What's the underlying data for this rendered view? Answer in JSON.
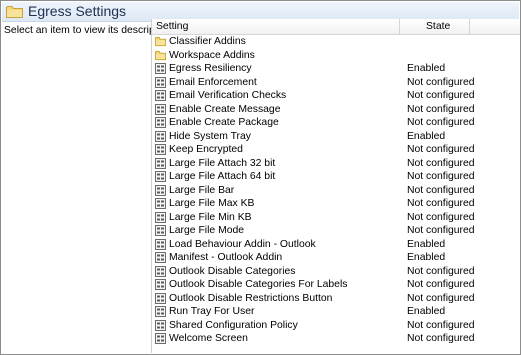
{
  "window": {
    "title": "Egress Settings"
  },
  "description_pane": {
    "text": "Select an item to view its description."
  },
  "columns": {
    "setting": "Setting",
    "state": "State"
  },
  "items": [
    {
      "name": "Classifier Addins",
      "state": "",
      "icon": "folder-icon"
    },
    {
      "name": "Workspace Addins",
      "state": "",
      "icon": "folder-icon"
    },
    {
      "name": "Egress Resiliency",
      "state": "Enabled",
      "icon": "policy-setting-icon"
    },
    {
      "name": "Email Enforcement",
      "state": "Not configured",
      "icon": "policy-setting-icon"
    },
    {
      "name": "Email Verification Checks",
      "state": "Not configured",
      "icon": "policy-setting-icon"
    },
    {
      "name": "Enable Create Message",
      "state": "Not configured",
      "icon": "policy-setting-icon"
    },
    {
      "name": "Enable Create Package",
      "state": "Not configured",
      "icon": "policy-setting-icon"
    },
    {
      "name": "Hide System Tray",
      "state": "Enabled",
      "icon": "policy-setting-icon"
    },
    {
      "name": "Keep Encrypted",
      "state": "Not configured",
      "icon": "policy-setting-icon"
    },
    {
      "name": "Large File Attach 32 bit",
      "state": "Not configured",
      "icon": "policy-setting-icon"
    },
    {
      "name": "Large File Attach 64 bit",
      "state": "Not configured",
      "icon": "policy-setting-icon"
    },
    {
      "name": "Large File Bar",
      "state": "Not configured",
      "icon": "policy-setting-icon"
    },
    {
      "name": "Large File Max KB",
      "state": "Not configured",
      "icon": "policy-setting-icon"
    },
    {
      "name": "Large File Min KB",
      "state": "Not configured",
      "icon": "policy-setting-icon"
    },
    {
      "name": "Large File Mode",
      "state": "Not configured",
      "icon": "policy-setting-icon"
    },
    {
      "name": "Load Behaviour Addin - Outlook",
      "state": "Enabled",
      "icon": "policy-setting-icon"
    },
    {
      "name": "Manifest - Outlook Addin",
      "state": "Enabled",
      "icon": "policy-setting-icon"
    },
    {
      "name": "Outlook Disable Categories",
      "state": "Not configured",
      "icon": "policy-setting-icon"
    },
    {
      "name": "Outlook Disable Categories For Labels",
      "state": "Not configured",
      "icon": "policy-setting-icon"
    },
    {
      "name": "Outlook Disable Restrictions Button",
      "state": "Not configured",
      "icon": "policy-setting-icon"
    },
    {
      "name": "Run Tray For User",
      "state": "Enabled",
      "icon": "policy-setting-icon"
    },
    {
      "name": "Shared Configuration Policy",
      "state": "Not configured",
      "icon": "policy-setting-icon"
    },
    {
      "name": "Welcome Screen",
      "state": "Not configured",
      "icon": "policy-setting-icon"
    }
  ]
}
